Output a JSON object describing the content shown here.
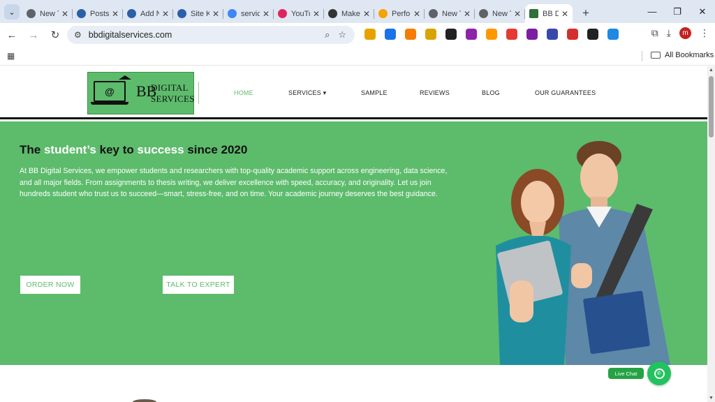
{
  "tabs": [
    {
      "title": "New Tab",
      "icon": "chrome-icon",
      "color": "#5f6368"
    },
    {
      "title": "Posts",
      "icon": "wp-logo-icon",
      "color": "#2b5fa8"
    },
    {
      "title": "Add New",
      "icon": "wp-logo-icon",
      "color": "#2b5fa8"
    },
    {
      "title": "Site Kit",
      "icon": "wp-logo-icon",
      "color": "#2b5fa8"
    },
    {
      "title": "services",
      "icon": "google-icon",
      "color": "#4285f4"
    },
    {
      "title": "YouTube",
      "icon": "youtube-icon",
      "color": "#e0245e"
    },
    {
      "title": "Make",
      "icon": "openai-icon",
      "color": "#333333"
    },
    {
      "title": "Performance",
      "icon": "analytics-icon",
      "color": "#f4a300"
    },
    {
      "title": "New Tab",
      "icon": "chrome-icon",
      "color": "#5f6368"
    },
    {
      "title": "New Tab",
      "icon": "chrome-icon",
      "color": "#5f6368"
    }
  ],
  "active_tab": {
    "title": "BB Digital Services",
    "icon": "site-favicon-icon",
    "color": "#2f6f3a"
  },
  "toolbar": {
    "url": "bbdigitalservices.com",
    "profile_initial": "m"
  },
  "extensions": [
    {
      "name": "ext-1-icon",
      "color": "#e8a200"
    },
    {
      "name": "ext-2-icon",
      "color": "#1a73e8"
    },
    {
      "name": "ext-3-icon",
      "color": "#f57c00"
    },
    {
      "name": "ext-4-icon",
      "color": "#d9a400"
    },
    {
      "name": "ext-5-icon",
      "color": "#222222"
    },
    {
      "name": "ext-6-icon",
      "color": "#8e24aa"
    },
    {
      "name": "ext-7-icon",
      "color": "#ff9800"
    },
    {
      "name": "ext-8-icon",
      "color": "#e53935"
    },
    {
      "name": "ext-9-icon",
      "color": "#7b1fa2"
    },
    {
      "name": "ext-10-icon",
      "color": "#3949ab"
    },
    {
      "name": "ext-11-icon",
      "color": "#d32f2f"
    },
    {
      "name": "ext-12-icon",
      "color": "#212121"
    },
    {
      "name": "ext-13-icon",
      "color": "#1e88e5"
    }
  ],
  "bookmarks": {
    "all_label": "All Bookmarks"
  },
  "site": {
    "logo_line1": "DIGITAL",
    "logo_line2": "SERVICES",
    "logo_mark": "BB",
    "logo_at": "@",
    "nav": [
      {
        "label": "HOME",
        "active": true
      },
      {
        "label": "SERVICES ▾",
        "active": false
      },
      {
        "label": "SAMPLE",
        "active": false
      },
      {
        "label": "REVIEWS",
        "active": false
      },
      {
        "label": "BLOG",
        "active": false
      },
      {
        "label": "OUR GUARANTEES",
        "active": false
      }
    ]
  },
  "hero": {
    "headline": {
      "p1": "The ",
      "p2": "student’s",
      "p3": " key to ",
      "p4": "success",
      "p5": " since 2020"
    },
    "body": "At BB Digital Services, we empower students and researchers with top-quality academic support across engineering, data science, and all major fields. From assignments to thesis writing, we deliver excellence with speed, accuracy, and originality. Let us join hundreds student who trust us to succeed—smart, stress-free, and on time. Your academic journey deserves the best guidance.",
    "cta_order": "ORDER NOW",
    "cta_expert": "TALK TO EXPERT"
  },
  "chat": {
    "live_chat_label": "Live Chat"
  },
  "colors": {
    "brand_green": "#5dbb6c",
    "chat_green": "#22c35e"
  }
}
